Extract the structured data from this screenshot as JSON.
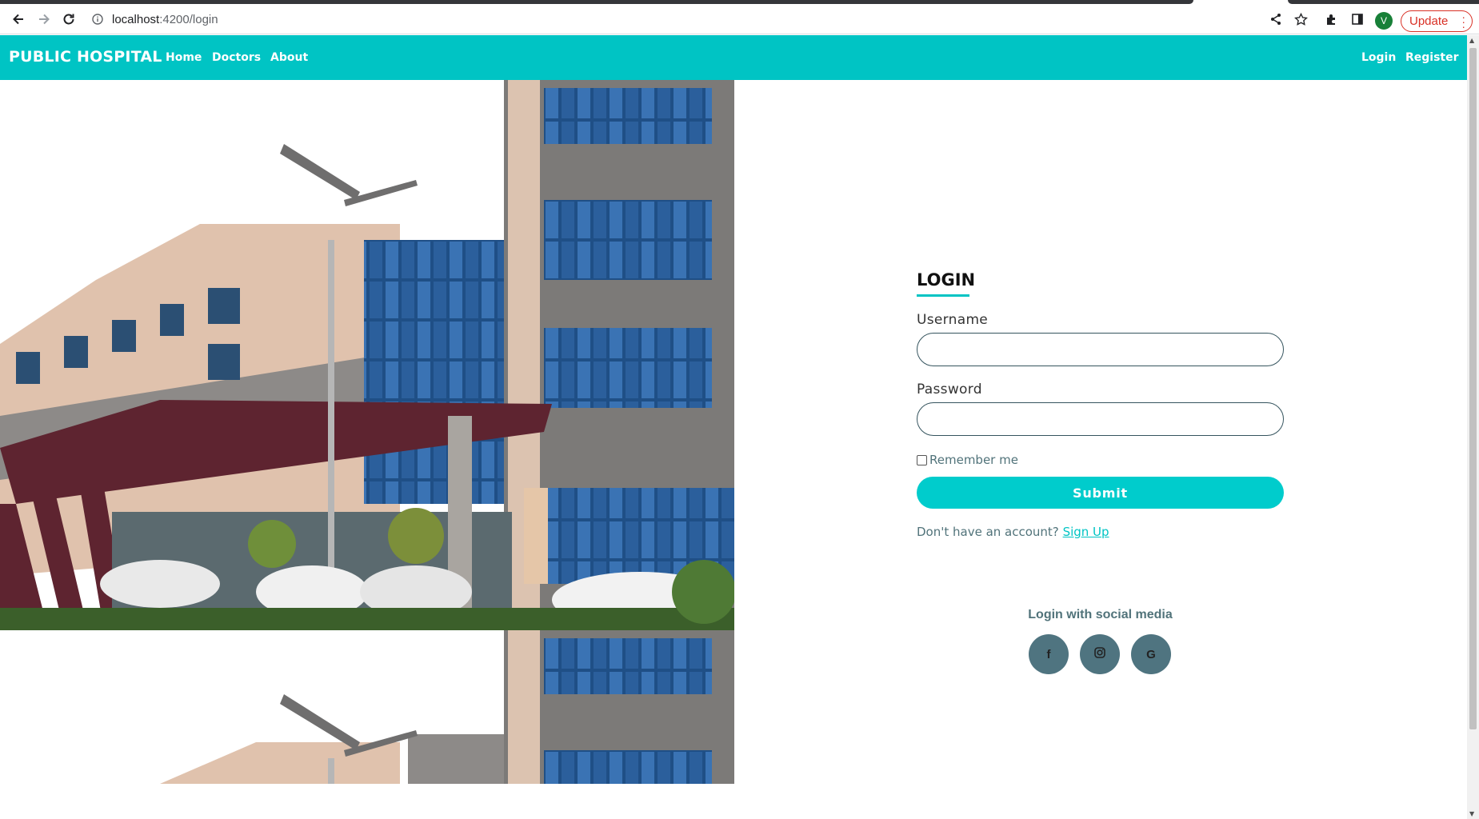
{
  "browser": {
    "url_host": "localhost",
    "url_rest": ":4200/login",
    "avatar_letter": "V",
    "update_label": "Update"
  },
  "nav": {
    "brand": "PUBLIC HOSPITAL",
    "links": [
      "Home",
      "Doctors",
      "About"
    ],
    "right_links": [
      "Login",
      "Register"
    ],
    "color": "#00c4c4"
  },
  "login": {
    "title": "LOGIN",
    "username_label": "Username",
    "username_value": "",
    "password_label": "Password",
    "password_value": "",
    "remember_label": "Remember me",
    "remember_checked": false,
    "submit_label": "Submit",
    "no_account_text": "Don't have an account?",
    "signup_link": "Sign Up",
    "social_title": "Login with social media",
    "social_buttons": [
      {
        "icon": "facebook-icon",
        "glyph": "f"
      },
      {
        "icon": "instagram-icon",
        "glyph": ""
      },
      {
        "icon": "google-icon",
        "glyph": "G"
      }
    ]
  }
}
